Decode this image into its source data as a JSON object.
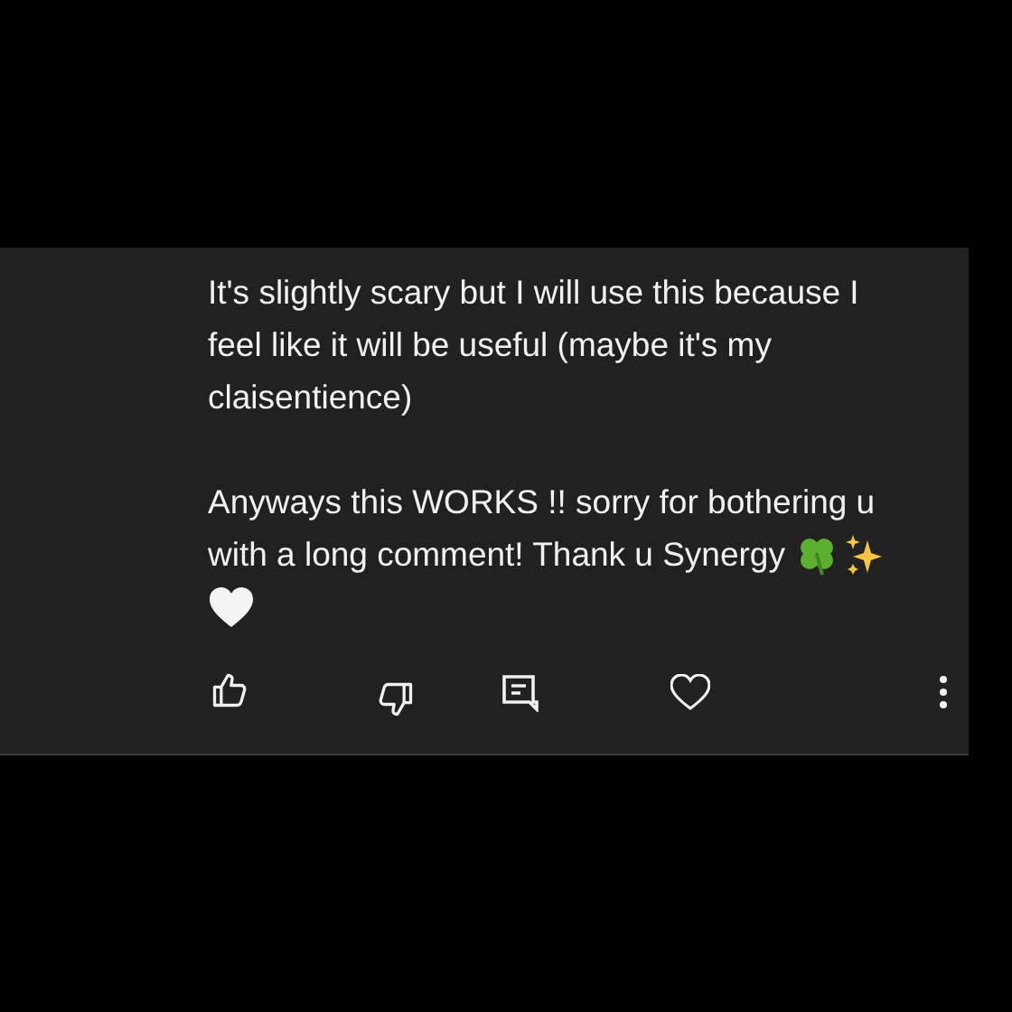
{
  "comment": {
    "paragraphs": [
      "It's slightly scary but I will use this because I feel like it will be useful (maybe it's my claisentience)"
    ],
    "lines": [
      "Anyways this WORKS !! sorry for bothering u",
      "with a long comment! Thank u Synergy"
    ]
  }
}
